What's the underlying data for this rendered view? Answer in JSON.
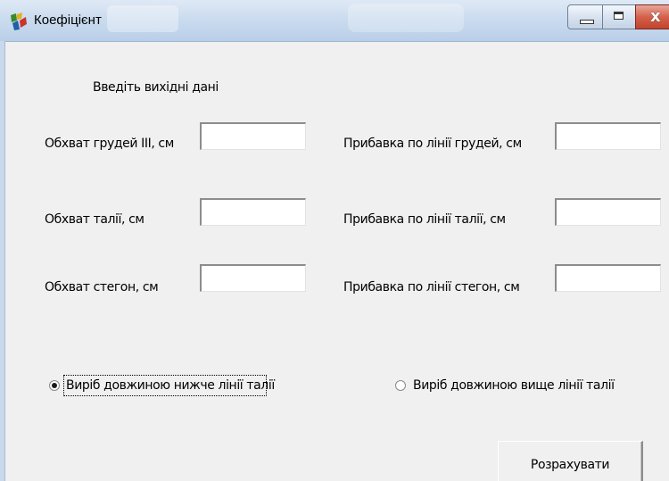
{
  "window": {
    "title": "Коефіцієнт",
    "controls": {
      "minimize": "—",
      "maximize": "□",
      "close": "x"
    }
  },
  "form": {
    "heading": "Введіть вихідні дані",
    "fields": [
      {
        "label": "Обхват грудей III, см",
        "value": ""
      },
      {
        "label": "Обхват талії, см",
        "value": ""
      },
      {
        "label": "Обхват стегон, см",
        "value": ""
      },
      {
        "label": "Прибавка по лінії грудей, см",
        "value": ""
      },
      {
        "label": "Прибавка по лінії талії, см",
        "value": ""
      },
      {
        "label": "Прибавка по лінії стегон, см",
        "value": ""
      }
    ],
    "radios": [
      {
        "label": "Виріб довжиною нижче лінії талії",
        "checked": true
      },
      {
        "label": "Виріб довжиною вище лінії талії",
        "checked": false
      }
    ],
    "calculate_button": "Розрахувати"
  },
  "icons": {
    "app": "app-icon"
  }
}
